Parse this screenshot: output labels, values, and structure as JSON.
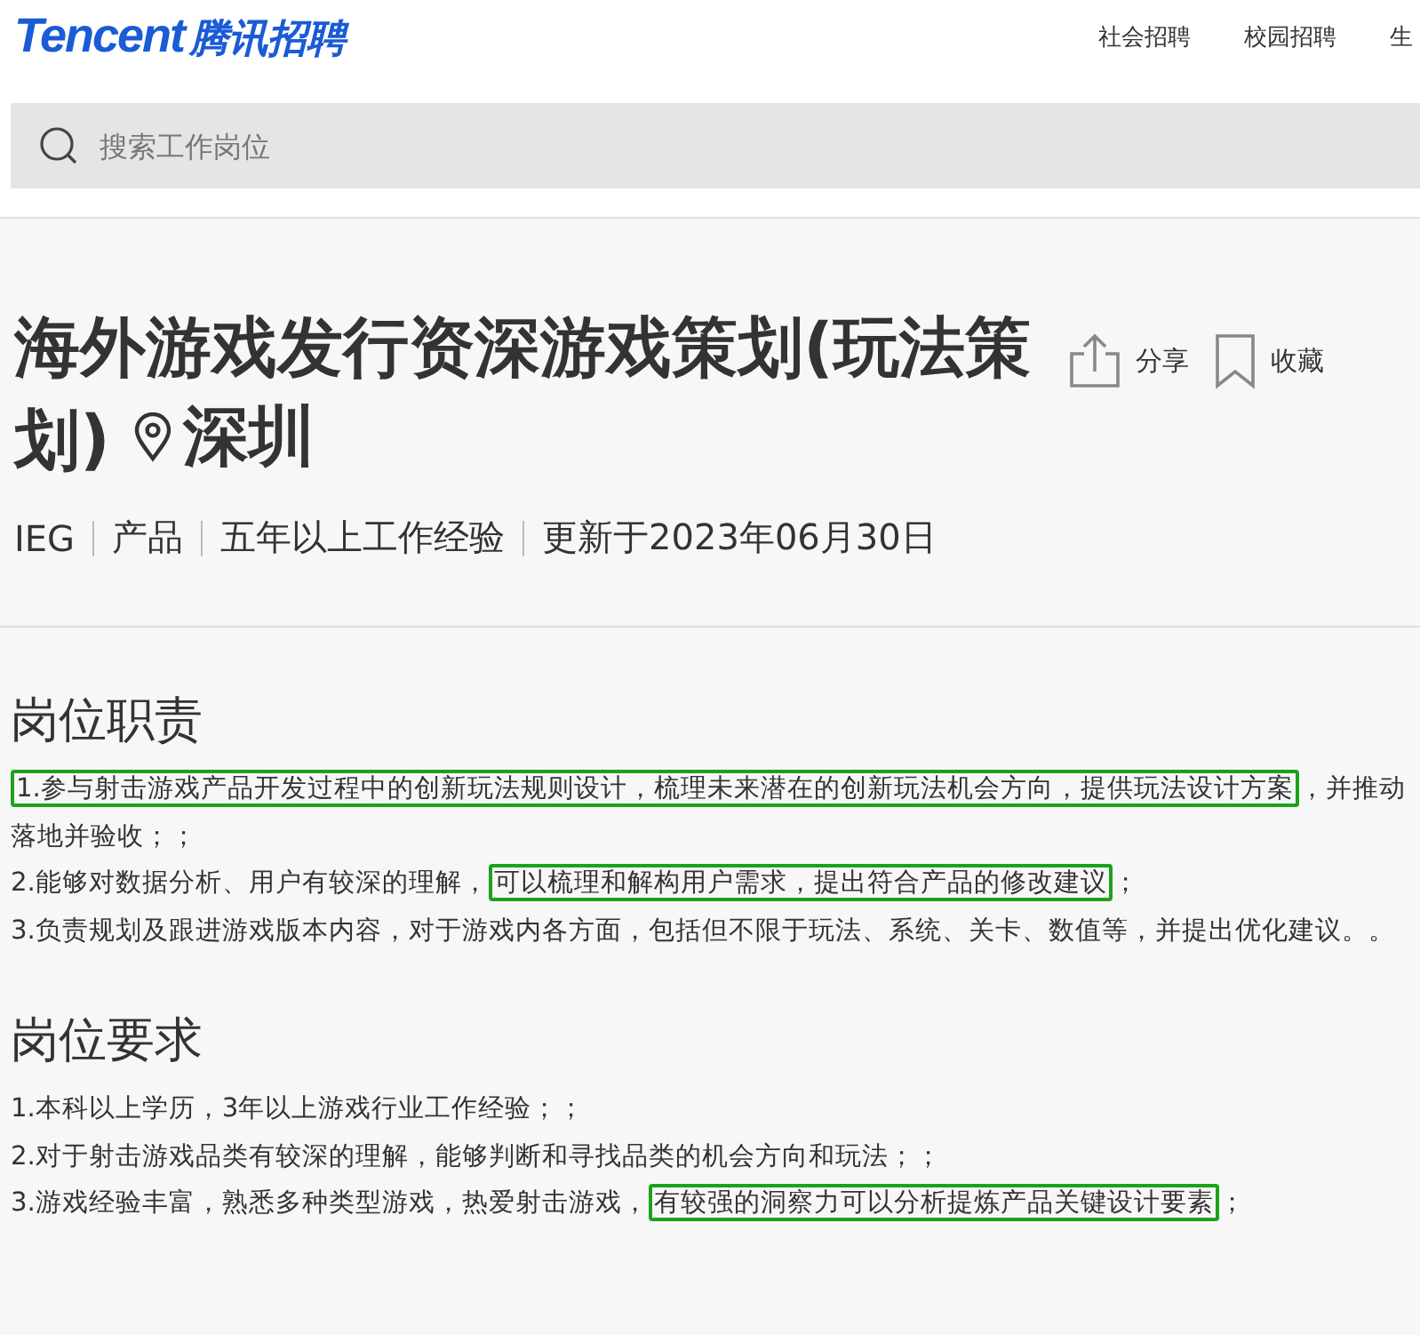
{
  "header": {
    "logo_en": "Tencent",
    "logo_cn": "腾讯招聘",
    "nav": [
      "社会招聘",
      "校园招聘",
      "生"
    ]
  },
  "search": {
    "placeholder": "搜索工作岗位"
  },
  "job": {
    "title": "海外游戏发行资深游戏策划(玩法策划)",
    "location": "深圳",
    "actions": [
      {
        "kind": "share",
        "label": "分享"
      },
      {
        "kind": "bookmark",
        "label": "收藏"
      }
    ],
    "meta": [
      "IEG",
      "产品",
      "五年以上工作经验",
      "更新于2023年06月30日"
    ]
  },
  "sections": [
    {
      "heading": "岗位职责",
      "items": [
        [
          {
            "text": "1.参与射击游戏产品开发过程中的创新玩法规则设计，梳理未来潜在的创新玩法机会方向，提供玩法设计方案",
            "highlighted": true
          },
          {
            "text": "，并推动落地并验收；；",
            "highlighted": false
          }
        ],
        [
          {
            "text": "2.能够对数据分析、用户有较深的理解，",
            "highlighted": false
          },
          {
            "text": "可以梳理和解构用户需求，提出符合产品的修改建议",
            "highlighted": true
          },
          {
            "text": "；",
            "highlighted": false
          }
        ],
        [
          {
            "text": "3.负责规划及跟进游戏版本内容，对于游戏内各方面，包括但不限于玩法、系统、关卡、数值等，并提出优化建议。。",
            "highlighted": false
          }
        ]
      ]
    },
    {
      "heading": "岗位要求",
      "items": [
        [
          {
            "text": "1.本科以上学历，3年以上游戏行业工作经验；；",
            "highlighted": false
          }
        ],
        [
          {
            "text": "2.对于射击游戏品类有较深的理解，能够判断和寻找品类的机会方向和玩法；；",
            "highlighted": false
          }
        ],
        [
          {
            "text": "3.游戏经验丰富，熟悉多种类型游戏，热爱射击游戏，",
            "highlighted": false
          },
          {
            "text": "有较强的洞察力可以分析提炼产品关键设计要素",
            "highlighted": true
          },
          {
            "text": "；",
            "highlighted": false
          }
        ]
      ]
    }
  ]
}
